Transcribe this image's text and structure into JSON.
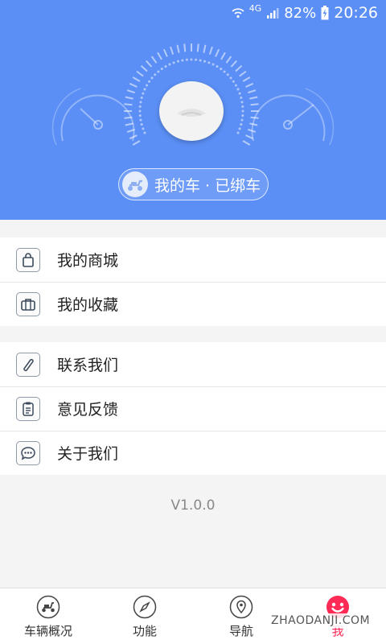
{
  "status_bar": {
    "network": "4G",
    "battery": "82%",
    "time": "20:26"
  },
  "header": {
    "car_status": "我的车 · 已绑车"
  },
  "menu": {
    "group1": [
      {
        "label": "我的商城",
        "icon": "shopping-bag-icon"
      },
      {
        "label": "我的收藏",
        "icon": "briefcase-icon"
      }
    ],
    "group2": [
      {
        "label": "联系我们",
        "icon": "phone-icon"
      },
      {
        "label": "意见反馈",
        "icon": "clipboard-icon"
      },
      {
        "label": "关于我们",
        "icon": "chat-bubble-icon"
      }
    ]
  },
  "version": "V1.0.0",
  "tabs": [
    {
      "label": "车辆概况",
      "icon": "scooter-icon"
    },
    {
      "label": "功能",
      "icon": "compass-icon"
    },
    {
      "label": "导航",
      "icon": "location-pin-icon"
    },
    {
      "label": "我",
      "icon": "smiley-face-icon",
      "active": true
    }
  ],
  "watermark": "ZHAODANJI.COM",
  "colors": {
    "header_bg": "#5b8ff5",
    "active_tab": "#ff2a55",
    "page_bg": "#f4f4f4"
  }
}
